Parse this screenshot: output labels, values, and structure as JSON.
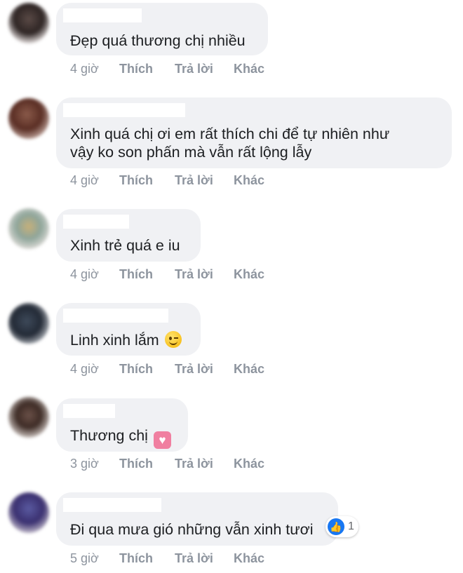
{
  "comments": [
    {
      "text": "Đẹp quá thương chị nhiều",
      "time": "4 giờ",
      "like": "Thích",
      "reply": "Trả lời",
      "more": "Khác"
    },
    {
      "text_line1": "Xinh quá chị ơi em rất thích chi để tự nhiên như",
      "text_line2": "vậy ko son phấn mà vẫn rất lộng lẫy",
      "time": "4 giờ",
      "like": "Thích",
      "reply": "Trả lời",
      "more": "Khác"
    },
    {
      "text": "Xinh trẻ quá e iu",
      "time": "4 giờ",
      "like": "Thích",
      "reply": "Trả lời",
      "more": "Khác"
    },
    {
      "text": "Linh xinh lắm",
      "emoji": "wink-emoji",
      "time": "4 giờ",
      "like": "Thích",
      "reply": "Trả lời",
      "more": "Khác"
    },
    {
      "text": "Thương chị",
      "emoji": "heart-emoji",
      "time": "3 giờ",
      "like": "Thích",
      "reply": "Trả lời",
      "more": "Khác"
    },
    {
      "text": "Đi qua mưa gió những vẫn xinh tươi",
      "reaction_icon": "thumbs-up-icon",
      "reaction_count": "1",
      "time": "5 giờ",
      "like": "Thích",
      "reply": "Trả lời",
      "more": "Khác"
    }
  ],
  "colors": {
    "bubble": "#f0f1f4",
    "text": "#1c1e21",
    "meta": "#8d949e",
    "like_reaction": "#1877f2"
  }
}
